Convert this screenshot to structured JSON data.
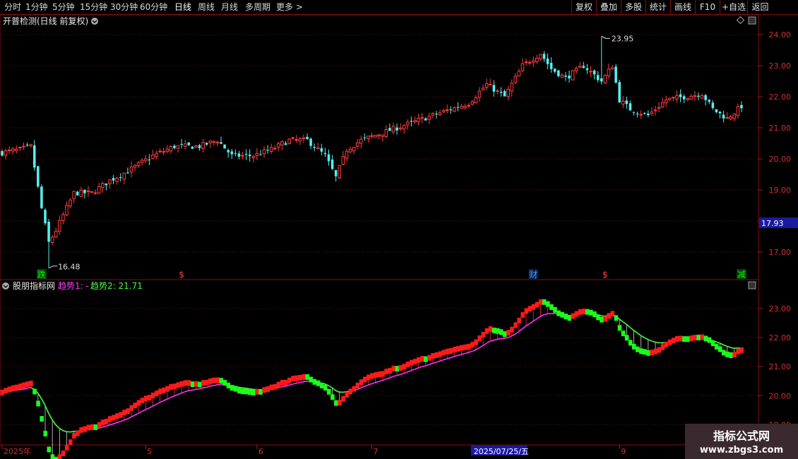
{
  "toolbar": {
    "periods": [
      "分时",
      "1分钟",
      "5分钟",
      "15分钟",
      "30分钟",
      "60分钟",
      "日线",
      "周线",
      "月线",
      "多周期",
      "更多 >"
    ],
    "active_period": "日线",
    "right_buttons": [
      "复权",
      "叠加",
      "多股",
      "统计",
      "画线",
      "F10",
      "+自选",
      "返回"
    ]
  },
  "main_panel": {
    "title": "开普检测(日线 前复权)",
    "high_label": "23.95",
    "low_label": "16.48",
    "current_price": "17.93",
    "markers": [
      {
        "text": "跌",
        "color": "#00ff00",
        "bg": "#0a3a0a",
        "date_index": 11
      },
      {
        "text": "$",
        "color": "#ff4040",
        "bg": "",
        "date_index": 50
      },
      {
        "text": "财",
        "color": "#40a0ff",
        "bg": "#0a1a40",
        "date_index": 148
      },
      {
        "text": "$",
        "color": "#ff4040",
        "bg": "",
        "date_index": 168
      },
      {
        "text": "减",
        "color": "#00ff00",
        "bg": "#0a3a0a",
        "date_index": 206
      }
    ]
  },
  "indicator_panel": {
    "title": "股朋指标网",
    "series1_label": "趋势1: -",
    "series2_label": "趋势2: 21.71"
  },
  "time_axis": {
    "labels": [
      {
        "text": "2025年",
        "date_index": 0
      },
      {
        "text": "5",
        "date_index": 40
      },
      {
        "text": "6",
        "date_index": 71
      },
      {
        "text": "7",
        "date_index": 103
      },
      {
        "text": "2025/07/25/五",
        "date_index": 131
      },
      {
        "text": "9",
        "date_index": 172
      }
    ]
  },
  "chart_data": [
    {
      "type": "candlestick",
      "title": "开普检测(日线 前复权)",
      "ylim": [
        16.2,
        24.3
      ],
      "yticks": [
        17.0,
        18.0,
        19.0,
        20.0,
        21.0,
        22.0,
        23.0,
        24.0
      ],
      "grid": true,
      "notes": "Daily OHLC, approx. 206 trading days; generated from key price path anchors",
      "anchors": [
        {
          "i": 0,
          "c": 20.2
        },
        {
          "i": 5,
          "c": 20.3
        },
        {
          "i": 8,
          "c": 20.4
        },
        {
          "i": 11,
          "c": 18.4
        },
        {
          "i": 13,
          "c": 17.3
        },
        {
          "i": 15,
          "c": 17.7
        },
        {
          "i": 20,
          "c": 18.9
        },
        {
          "i": 25,
          "c": 18.9
        },
        {
          "i": 30,
          "c": 19.3
        },
        {
          "i": 35,
          "c": 19.6
        },
        {
          "i": 42,
          "c": 20.1
        },
        {
          "i": 48,
          "c": 20.4
        },
        {
          "i": 55,
          "c": 20.4
        },
        {
          "i": 60,
          "c": 20.6
        },
        {
          "i": 64,
          "c": 20.1
        },
        {
          "i": 70,
          "c": 20.1
        },
        {
          "i": 75,
          "c": 20.3
        },
        {
          "i": 80,
          "c": 20.6
        },
        {
          "i": 85,
          "c": 20.6
        },
        {
          "i": 90,
          "c": 20.1
        },
        {
          "i": 93,
          "c": 19.4
        },
        {
          "i": 96,
          "c": 20.3
        },
        {
          "i": 100,
          "c": 20.6
        },
        {
          "i": 110,
          "c": 21.0
        },
        {
          "i": 120,
          "c": 21.4
        },
        {
          "i": 130,
          "c": 21.8
        },
        {
          "i": 135,
          "c": 22.4
        },
        {
          "i": 140,
          "c": 22.0
        },
        {
          "i": 145,
          "c": 23.0
        },
        {
          "i": 150,
          "c": 23.4
        },
        {
          "i": 153,
          "c": 22.9
        },
        {
          "i": 157,
          "c": 22.6
        },
        {
          "i": 162,
          "c": 23.0
        },
        {
          "i": 167,
          "c": 22.5
        },
        {
          "i": 170,
          "c": 23.0
        },
        {
          "i": 172,
          "c": 21.9
        },
        {
          "i": 175,
          "c": 21.6
        },
        {
          "i": 180,
          "c": 21.4
        },
        {
          "i": 185,
          "c": 21.9
        },
        {
          "i": 190,
          "c": 22.0
        },
        {
          "i": 195,
          "c": 22.1
        },
        {
          "i": 198,
          "c": 21.6
        },
        {
          "i": 202,
          "c": 21.3
        },
        {
          "i": 206,
          "c": 21.7
        }
      ],
      "high_point": {
        "i": 167,
        "value": 23.95
      },
      "low_point": {
        "i": 13,
        "value": 16.48
      }
    },
    {
      "type": "line",
      "title": "股朋指标网",
      "ylim": [
        18.4,
        23.9
      ],
      "yticks": [
        19.0,
        20.0,
        21.0,
        22.0,
        23.0
      ],
      "grid": true,
      "series": [
        {
          "name": "趋势1",
          "style": "stepped blocks red (up) / green (down)",
          "source": "smoothed close"
        },
        {
          "name": "趋势2",
          "style": "line green (up) / magenta (down) with hatch",
          "last_value": 21.71
        }
      ]
    }
  ]
}
